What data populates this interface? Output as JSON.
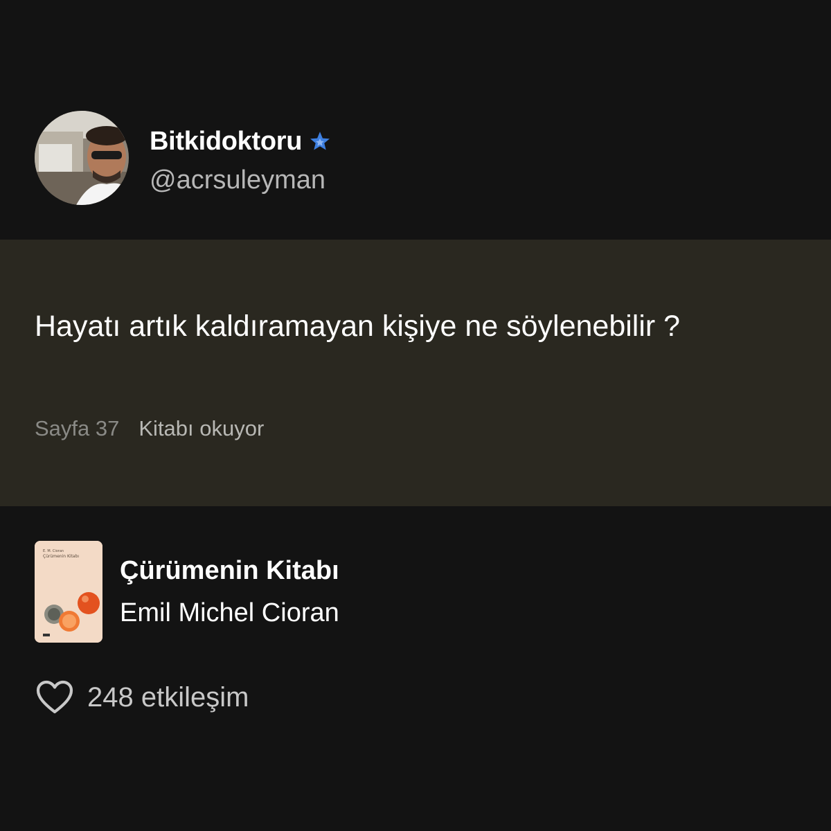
{
  "profile": {
    "display_name": "Bitkidoktoru",
    "handle": "@acrsuleyman",
    "verified_icon": "star-badge-icon",
    "accent_color": "#3d7fe0"
  },
  "quote": {
    "text": "Hayatı artık kaldıramayan kişiye ne söylenebilir ?",
    "page": "Sayfa 37",
    "status": "Kitabı okuyor",
    "background_color": "#2a2820"
  },
  "book": {
    "title": "Çürümenin Kitabı",
    "author": "Emil Michel Cioran",
    "cover_author": "E. M. Cioran",
    "cover_title": "Çürümenin Kitabı"
  },
  "interactions": {
    "icon": "heart-outline-icon",
    "label": "248 etkileşim"
  }
}
